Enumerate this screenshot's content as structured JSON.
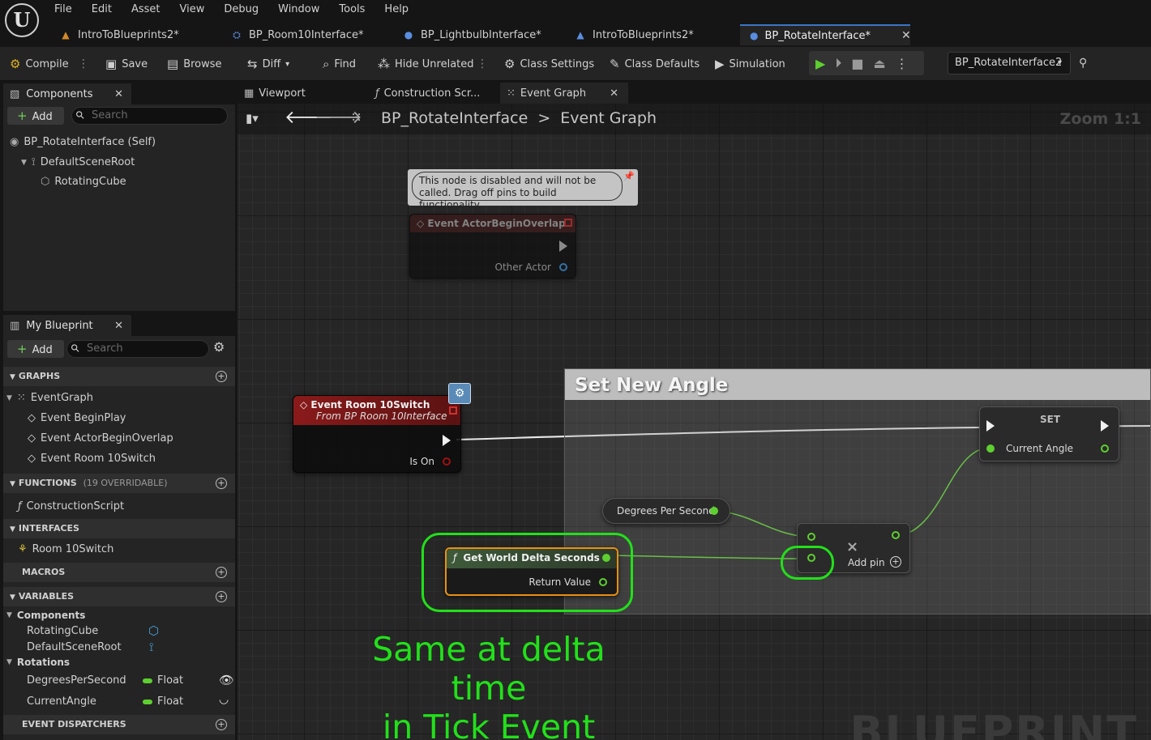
{
  "menu": [
    "File",
    "Edit",
    "Asset",
    "View",
    "Debug",
    "Window",
    "Tools",
    "Help"
  ],
  "doc_tabs": [
    "IntroToBlueprints2*",
    "BP_Room10Interface*",
    "BP_LightbulbInterface*",
    "IntroToBlueprints2*",
    "BP_RotateInterface*"
  ],
  "toolbar": {
    "compile": "Compile",
    "save": "Save",
    "browse": "Browse",
    "diff": "Diff",
    "find": "Find",
    "hide_unrelated": "Hide Unrelated",
    "class_settings": "Class Settings",
    "class_defaults": "Class Defaults",
    "simulation": "Simulation",
    "debug_object": "BP_RotateInterface2"
  },
  "components": {
    "tab": "Components",
    "add": "Add",
    "search_placeholder": "Search",
    "tree": [
      "BP_RotateInterface (Self)",
      "DefaultSceneRoot",
      "RotatingCube"
    ]
  },
  "my_blueprint": {
    "tab": "My Blueprint",
    "add": "Add",
    "search_placeholder": "Search",
    "graphs_hdr": "GRAPHS",
    "graphs": [
      "EventGraph",
      "Event BeginPlay",
      "Event ActorBeginOverlap",
      "Event Room 10Switch"
    ],
    "functions_hdr": "FUNCTIONS",
    "functions_count": "(19 OVERRIDABLE)",
    "functions": [
      "ConstructionScript"
    ],
    "interfaces_hdr": "INTERFACES",
    "interfaces": [
      "Room 10Switch"
    ],
    "macros_hdr": "MACROS",
    "variables_hdr": "VARIABLES",
    "var_cat_components": "Components",
    "var_components": [
      "RotatingCube",
      "DefaultSceneRoot"
    ],
    "var_cat_rotations": "Rotations",
    "var_rotations": [
      {
        "name": "DegreesPerSecond",
        "type": "Float"
      },
      {
        "name": "CurrentAngle",
        "type": "Float"
      }
    ],
    "dispatchers_hdr": "EVENT DISPATCHERS"
  },
  "graph_tabs": [
    "Viewport",
    "Construction Scr...",
    "Event Graph"
  ],
  "breadcrumb": {
    "bp": "BP_RotateInterface",
    "sep": ">",
    "graph": "Event Graph"
  },
  "zoom": "Zoom 1:1",
  "watermark": "BLUEPRINT",
  "disabled_note": "This node is disabled and will not be called. Drag off pins to build functionality.",
  "nodes": {
    "overlap": {
      "title": "Event ActorBeginOverlap",
      "pin": "Other Actor"
    },
    "room_switch": {
      "title": "Event Room 10Switch",
      "subtitle": "From BP Room 10Interface",
      "pin": "Is On"
    },
    "comment": "Set New Angle",
    "set": {
      "title": "SET",
      "pin": "Current Angle"
    },
    "degrees": "Degrees Per Second",
    "add": {
      "add_pin": "Add pin",
      "symbol": "×"
    },
    "delta": {
      "title": "Get World Delta Seconds",
      "pin": "Return Value"
    }
  },
  "annotation": {
    "line1": "Same at delta time",
    "line2": "in Tick Event"
  },
  "colors": {
    "accent_green": "#22e01a",
    "float_pin": "#5ecf30",
    "event_red": "#8a1a1a",
    "tab_blue": "#3a76c6"
  }
}
